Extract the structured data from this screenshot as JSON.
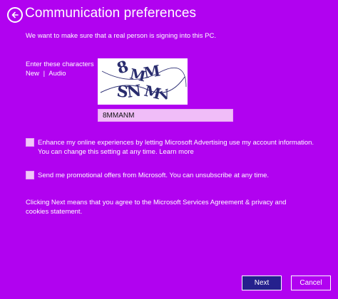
{
  "colors": {
    "background": "#b102f0",
    "next_button": "#25208d",
    "input_background": "#f0bdf8",
    "text": "#ffffff"
  },
  "header": {
    "back_icon": "back-arrow-icon",
    "title": "Communication preferences"
  },
  "intro_text": "We want to make sure that a real person is signing into this PC.",
  "captcha": {
    "label": "Enter these characters",
    "new_link": "New",
    "separator": "|",
    "audio_link": "Audio",
    "image_text": "8MMSNMV",
    "input_value": "8MMANM"
  },
  "options": [
    {
      "checked": false,
      "line1": "Enhance my online experiences by letting Microsoft Advertising use my account information.",
      "line2": "You can change this setting at any time. Learn more"
    },
    {
      "checked": false,
      "line1": "Send me promotional offers from Microsoft. You can unsubscribe at any time."
    }
  ],
  "agreement": "Clicking Next means that you agree to the Microsoft Services Agreement & privacy and cookies statement.",
  "buttons": {
    "next": "Next",
    "cancel": "Cancel"
  }
}
